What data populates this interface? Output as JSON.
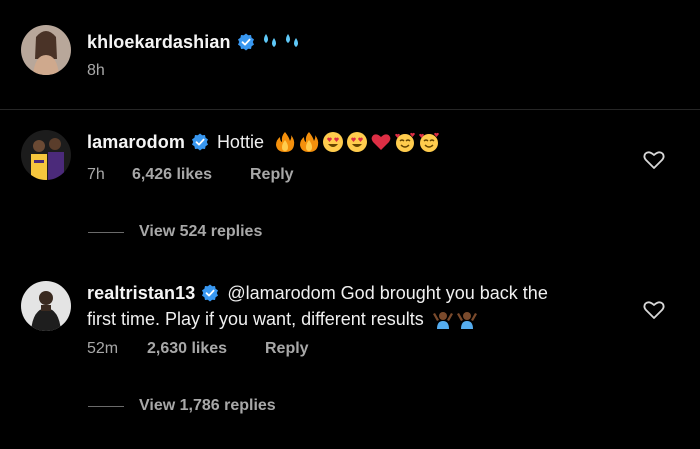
{
  "post": {
    "username": "khloekardashian",
    "verified": true,
    "emojis": [
      "sweat-droplets-emoji",
      "sweat-droplets-emoji"
    ],
    "time": "8h"
  },
  "comments": [
    {
      "username": "lamarodom",
      "verified": true,
      "text": "Hottie",
      "emojis": [
        "fire-emoji",
        "fire-emoji",
        "heart-eyes-emoji",
        "heart-eyes-emoji",
        "red-heart-emoji",
        "smiling-hearts-emoji",
        "smiling-hearts-emoji"
      ],
      "time": "7h",
      "likes": "6,426 likes",
      "reply": "Reply",
      "view_replies": "View 524 replies"
    },
    {
      "username": "realtristan13",
      "verified": true,
      "text_line1": "@lamarodom God brought you back the",
      "text_line2": "first time. Play if you want, different results",
      "emojis": [
        "person-shrugging-emoji",
        "person-shrugging-emoji"
      ],
      "time": "52m",
      "likes": "2,630 likes",
      "reply": "Reply",
      "view_replies": "View 1,786 replies"
    }
  ],
  "colors": {
    "background": "#000000",
    "text": "#f5f5f5",
    "muted": "#a8a8a8",
    "verified": "#3897f0"
  }
}
